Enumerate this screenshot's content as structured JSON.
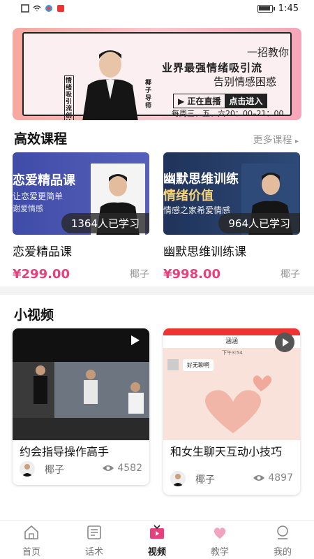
{
  "status": {
    "time": "1:45"
  },
  "banner": {
    "vertical_text": "情绪吸引流创始人",
    "name_text": "椰子导师",
    "line1": "一招教你",
    "line2": "业界最强情绪吸引流",
    "line3": "告别情感困惑",
    "live_label": "正在直播",
    "enter_label": "点击进入",
    "schedule": "每周三、五、六20：00–21：00"
  },
  "courses": {
    "title": "高效课程",
    "more_label": "更多课程",
    "items": [
      {
        "thumb_title": "恋爱精品课",
        "thumb_sub": "让恋爱更简单",
        "thumb_sub2": "谢爱情感",
        "learners": "1364人已学习",
        "name": "恋爱精品课",
        "price": "¥299.00",
        "author": "椰子"
      },
      {
        "thumb_title": "幽默思维训练",
        "thumb_title2": "情绪价值",
        "thumb_sub": "情感之家希爱情感",
        "learners": "964人已学习",
        "name": "幽默思维训练课",
        "price": "¥998.00",
        "author": "椰子"
      }
    ]
  },
  "videos": {
    "title": "小视频",
    "items": [
      {
        "title": "约会指导操作高手",
        "author": "椰子",
        "views": "4582"
      },
      {
        "title": "和女生聊天互动小技巧",
        "author": "椰子",
        "views": "4897",
        "chat_name": "涵涵",
        "chat_time": "下午3:54",
        "chat_msg": "好无聊啊"
      }
    ]
  },
  "tabs": [
    {
      "label": "首页",
      "icon": "home-icon"
    },
    {
      "label": "话术",
      "icon": "script-icon"
    },
    {
      "label": "视频",
      "icon": "tv-icon",
      "active": true
    },
    {
      "label": "教学",
      "icon": "heart-icon"
    },
    {
      "label": "我的",
      "icon": "profile-icon"
    }
  ],
  "colors": {
    "price": "#e8407b",
    "tab_active": "#222222"
  }
}
